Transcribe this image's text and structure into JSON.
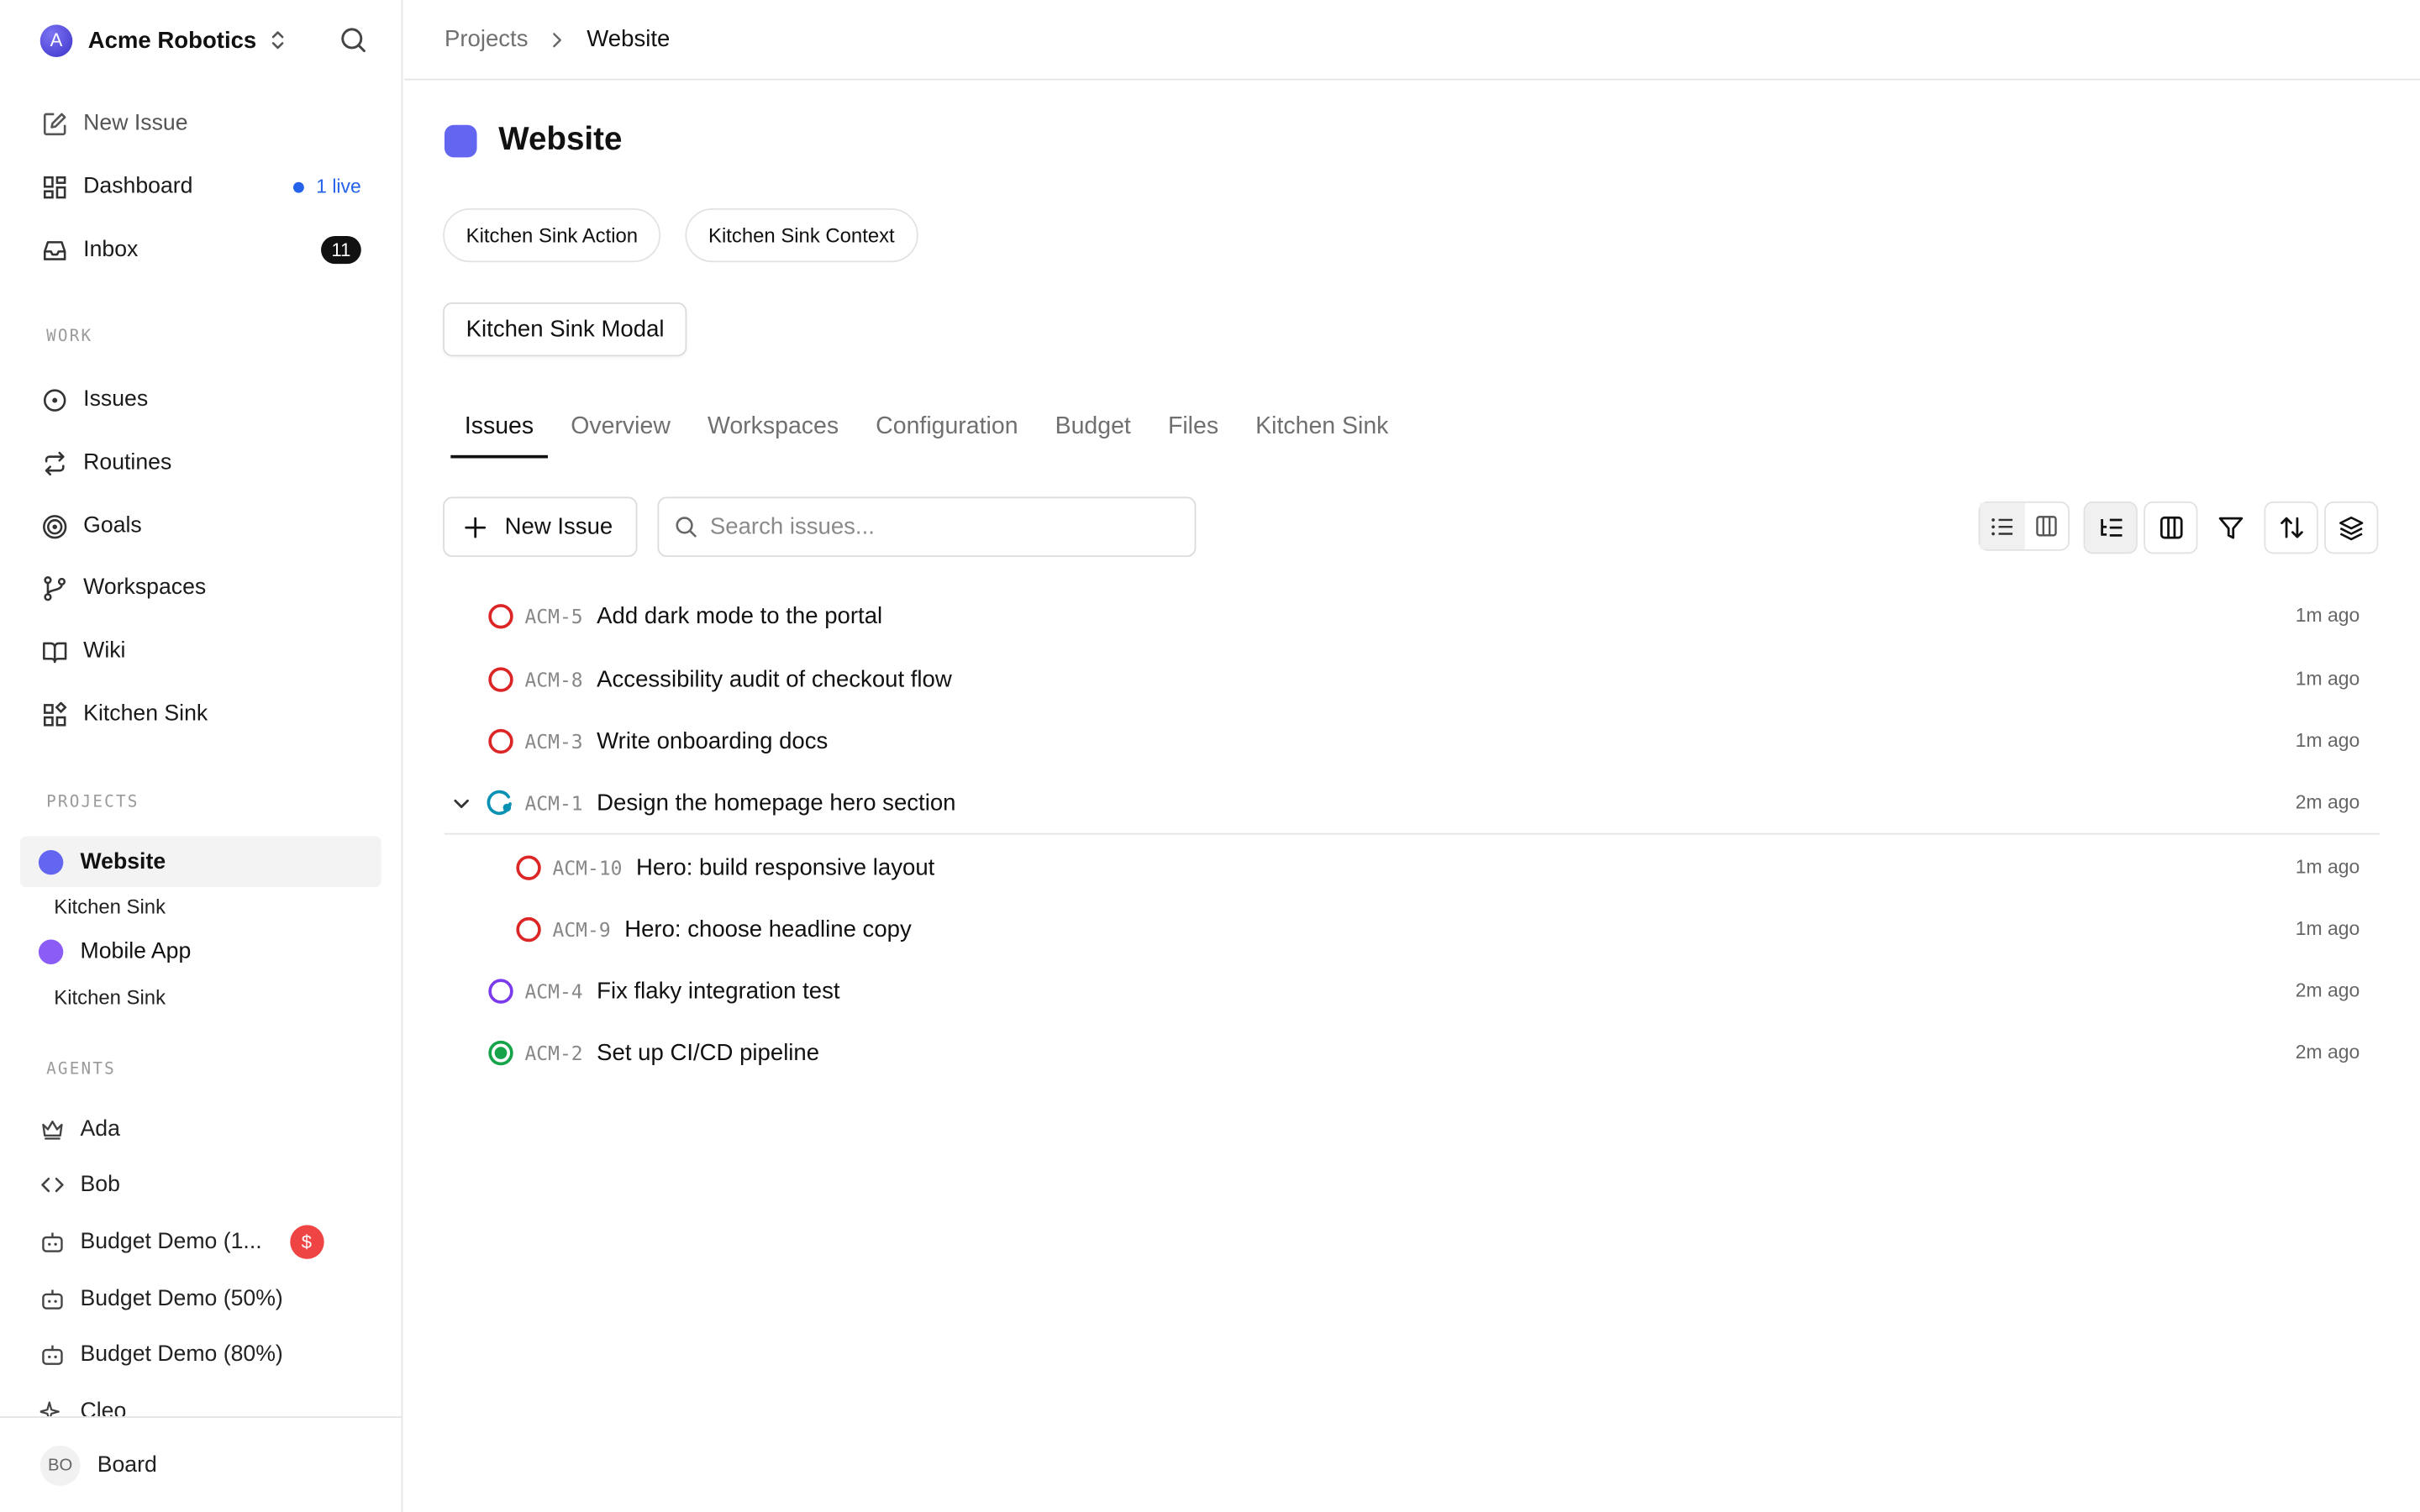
{
  "sidebar": {
    "org": {
      "initial": "A",
      "name": "Acme Robotics"
    },
    "nav": {
      "new_issue": "New Issue",
      "dashboard": "Dashboard",
      "dashboard_live": "1 live",
      "inbox": "Inbox",
      "inbox_count": "11"
    },
    "work_label": "WORK",
    "work": {
      "issues": "Issues",
      "routines": "Routines",
      "goals": "Goals",
      "workspaces": "Workspaces",
      "wiki": "Wiki",
      "kitchen_sink": "Kitchen Sink"
    },
    "projects_label": "PROJECTS",
    "projects": [
      {
        "name": "Website",
        "color": "#6366f1",
        "sub": "Kitchen Sink"
      },
      {
        "name": "Mobile App",
        "color": "#8b5cf6",
        "sub": "Kitchen Sink"
      }
    ],
    "agents_label": "AGENTS",
    "agents": [
      {
        "name": "Ada",
        "icon": "crown-icon"
      },
      {
        "name": "Bob",
        "icon": "code-icon"
      },
      {
        "name": "Budget Demo (1...",
        "icon": "bot-icon",
        "badge": "$"
      },
      {
        "name": "Budget Demo (50%)",
        "icon": "bot-icon"
      },
      {
        "name": "Budget Demo (80%)",
        "icon": "bot-icon"
      },
      {
        "name": "Cleo",
        "icon": "sparkle-icon"
      }
    ],
    "footer": {
      "initials": "BO",
      "name": "Board"
    }
  },
  "breadcrumb": {
    "parent": "Projects",
    "current": "Website"
  },
  "page": {
    "title": "Website",
    "color": "#6366f1",
    "actions": [
      "Kitchen Sink Action",
      "Kitchen Sink Context"
    ],
    "modal_button": "Kitchen Sink Modal",
    "tabs": [
      "Issues",
      "Overview",
      "Workspaces",
      "Configuration",
      "Budget",
      "Files",
      "Kitchen Sink"
    ],
    "active_tab": "Issues"
  },
  "toolbar": {
    "new_issue": "New Issue",
    "search_placeholder": "Search issues..."
  },
  "issues": [
    {
      "key": "ACM-5",
      "title": "Add dark mode to the portal",
      "time": "1m ago",
      "status": "todo",
      "status_color": "#dc2626"
    },
    {
      "key": "ACM-8",
      "title": "Accessibility audit of checkout flow",
      "time": "1m ago",
      "status": "todo",
      "status_color": "#dc2626"
    },
    {
      "key": "ACM-3",
      "title": "Write onboarding docs",
      "time": "1m ago",
      "status": "todo",
      "status_color": "#dc2626"
    },
    {
      "key": "ACM-1",
      "title": "Design the homepage hero section",
      "time": "2m ago",
      "status": "in-progress",
      "status_color": "#0891b2",
      "expanded": true
    },
    {
      "key": "ACM-10",
      "title": "Hero: build responsive layout",
      "time": "1m ago",
      "status": "todo",
      "status_color": "#dc2626",
      "child": true
    },
    {
      "key": "ACM-9",
      "title": "Hero: choose headline copy",
      "time": "1m ago",
      "status": "todo",
      "status_color": "#dc2626",
      "child": true
    },
    {
      "key": "ACM-4",
      "title": "Fix flaky integration test",
      "time": "2m ago",
      "status": "backlog",
      "status_color": "#7c3aed"
    },
    {
      "key": "ACM-2",
      "title": "Set up CI/CD pipeline",
      "time": "2m ago",
      "status": "done",
      "status_color": "#16a34a"
    }
  ]
}
